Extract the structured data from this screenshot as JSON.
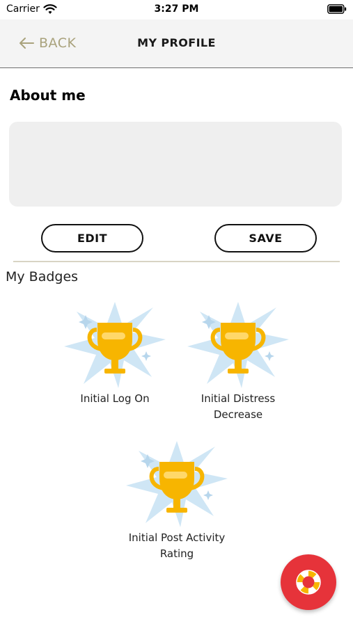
{
  "status_bar": {
    "carrier": "Carrier",
    "time": "3:27 PM",
    "wifi_icon": "wifi-icon",
    "battery_icon": "battery-icon"
  },
  "nav": {
    "back_label": "BACK",
    "back_icon": "arrow-left-icon",
    "title": "MY PROFILE"
  },
  "about": {
    "heading": "About me",
    "text": "",
    "edit_label": "EDIT",
    "save_label": "SAVE"
  },
  "badges": {
    "heading": "My Badges",
    "items": [
      {
        "label_lines": [
          "Initial Log On"
        ],
        "icon": "trophy-icon"
      },
      {
        "label_lines": [
          "Initial Distress",
          "Decrease"
        ],
        "icon": "trophy-icon"
      },
      {
        "label_lines": [
          "Initial Post Activity",
          "Rating"
        ],
        "icon": "trophy-icon"
      }
    ]
  },
  "fab": {
    "icon": "lifebuoy-icon"
  },
  "colors": {
    "accent_back": "#a9a27c",
    "trophy_gold": "#f7b500",
    "burst_blue": "#cfe6f5",
    "fab_red": "#e6333a"
  }
}
